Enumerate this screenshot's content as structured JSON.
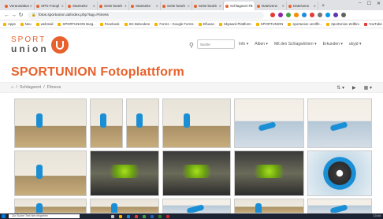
{
  "browser": {
    "tabs": [
      {
        "label": "Veranstaltun",
        "active": false
      },
      {
        "label": "SPO Fotopl",
        "active": false
      },
      {
        "label": "Startseite",
        "active": false
      },
      {
        "label": "Seite bearb",
        "active": false
      },
      {
        "label": "Startseite",
        "active": false
      },
      {
        "label": "Seite bearb",
        "active": false
      },
      {
        "label": "Seite bearb",
        "active": false
      },
      {
        "label": "Schlagwort Fit",
        "active": true
      },
      {
        "label": "Dateiverw",
        "active": false
      },
      {
        "label": "Dateiverw",
        "active": false
      }
    ],
    "new_tab": "+",
    "window_controls": [
      "–",
      "☐",
      "✕"
    ],
    "url": "fotos.sportunion.at/index.php?tag=Fitness",
    "bookmarks": [
      "Apps",
      "Neu",
      "webmail",
      "SPORTUNION Burg..",
      "Facebook",
      "SG Belvedere",
      "Forms - Google Forms",
      "Elfuuse",
      "Skyward Plattform",
      "SPORTUNION",
      "sportunion veröffe..",
      "SportUnion Zellbru",
      "YouTube"
    ]
  },
  "site": {
    "logo_top": "SPORT",
    "logo_bottom": "union",
    "search_placeholder": "Suche",
    "menu": [
      "Info ▾",
      "Alben ▾",
      "Mit den Schlagwörtern ▾",
      "Erkunden ▾",
      "ukyjd ▾"
    ],
    "title": "SPORTUNION Fotoplattform",
    "breadcrumb": [
      "⌂",
      "/",
      "Schlagwort",
      "/",
      "Fitness"
    ],
    "tools": [
      "⇅ ▾",
      "▶",
      "▦ ▾"
    ]
  },
  "taskbar": {
    "search_placeholder": "Zur Suche Text hier eingeben",
    "clock": "13:44"
  },
  "colors": {
    "brand": "#e8612c",
    "accent": "#1a8fd6"
  }
}
